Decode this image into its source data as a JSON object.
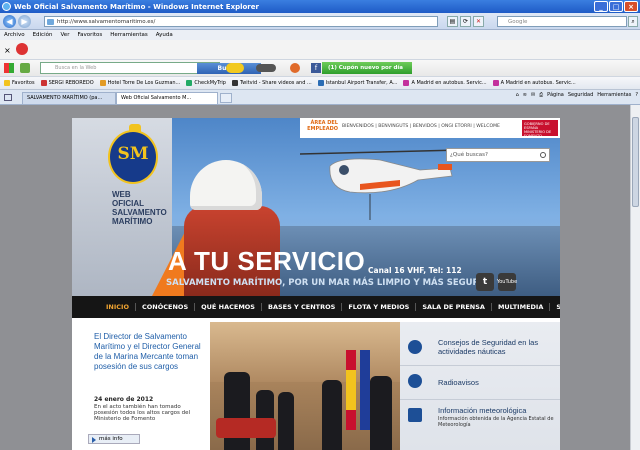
{
  "browser": {
    "title": "Web Oficial Salvamento Marítimo - Windows Internet Explorer",
    "url": "http://www.salvamentomaritimo.es/",
    "search_placeholder": "Google",
    "menu": [
      "Archivo",
      "Edición",
      "Ver",
      "Favoritos",
      "Herramientas",
      "Ayuda"
    ],
    "toolbar_search_placeholder": "Busca en la Web",
    "toolbar_search_button": "Buscar",
    "cupon_label": "(1) Cupón nuevo por día",
    "favorites_label": "Favoritos",
    "favorites": [
      "SERGI REBOREDO",
      "Hotel Torre De Los Guzman...",
      "CheckMyTrip",
      "Twitvid - Share videos and ...",
      "Istanbul Airport Transfer, A...",
      "A Madrid en autobus. Servic...",
      "A Madrid en autobus. Servic..."
    ],
    "tabs": [
      "SALVAMENTO MARÍTIMO (pa...",
      "Web Oficial Salvamento M..."
    ],
    "commands": [
      "Página",
      "Seguridad",
      "Herramientas"
    ]
  },
  "site": {
    "logo_text": "SM",
    "name_lines": [
      "WEB OFICIAL",
      "SALVAMENTO",
      "MARÍTIMO"
    ],
    "area_privada": "ÁREA DEL EMPLEADO",
    "languages": "BIENVENIDOS | BENVINGUTS | BENVIDOS | ONGI ETORRI | WELCOME",
    "gobierno": "GOBIERNO DE ESPAÑA  MINISTERIO DE FOMENTO",
    "search_placeholder": "¿Qué buscas?",
    "slogan": "A TU SERVICIO",
    "canal": "Canal 16 VHF, Tel: 112",
    "subslogan": "SALVAMENTO MARÍTIMO, POR UN MAR MÁS LIMPIO Y MÁS SEGURO",
    "social": [
      "twitter",
      "YouTube"
    ],
    "nav": [
      "INICIO",
      "CONÓCENOS",
      "QUÉ HACEMOS",
      "BASES Y CENTROS",
      "FLOTA Y MEDIOS",
      "SALA DE PRENSA",
      "MULTIMEDIA",
      "SEGURIDAD NÁUTICA"
    ],
    "news": {
      "title": "El Director de Salvamento Marítimo y el Director General de la Marina Mercante toman posesión de sus cargos",
      "date": "24 enero de 2012",
      "body": "En el acto también han tomado posesión todos los altos cargos del Ministerio de Fomento",
      "more": "más info"
    },
    "right_items": [
      {
        "title": "Consejos de Seguridad en las actividades náuticas",
        "sub": "",
        "icon": "boat-icon"
      },
      {
        "title": "Radioavisos",
        "sub": "",
        "icon": "radio-icon"
      },
      {
        "title": "Información meteorológica",
        "sub": "Información obtenida de la Agencia Estatal de Meteorología",
        "icon": "document-icon"
      }
    ]
  }
}
